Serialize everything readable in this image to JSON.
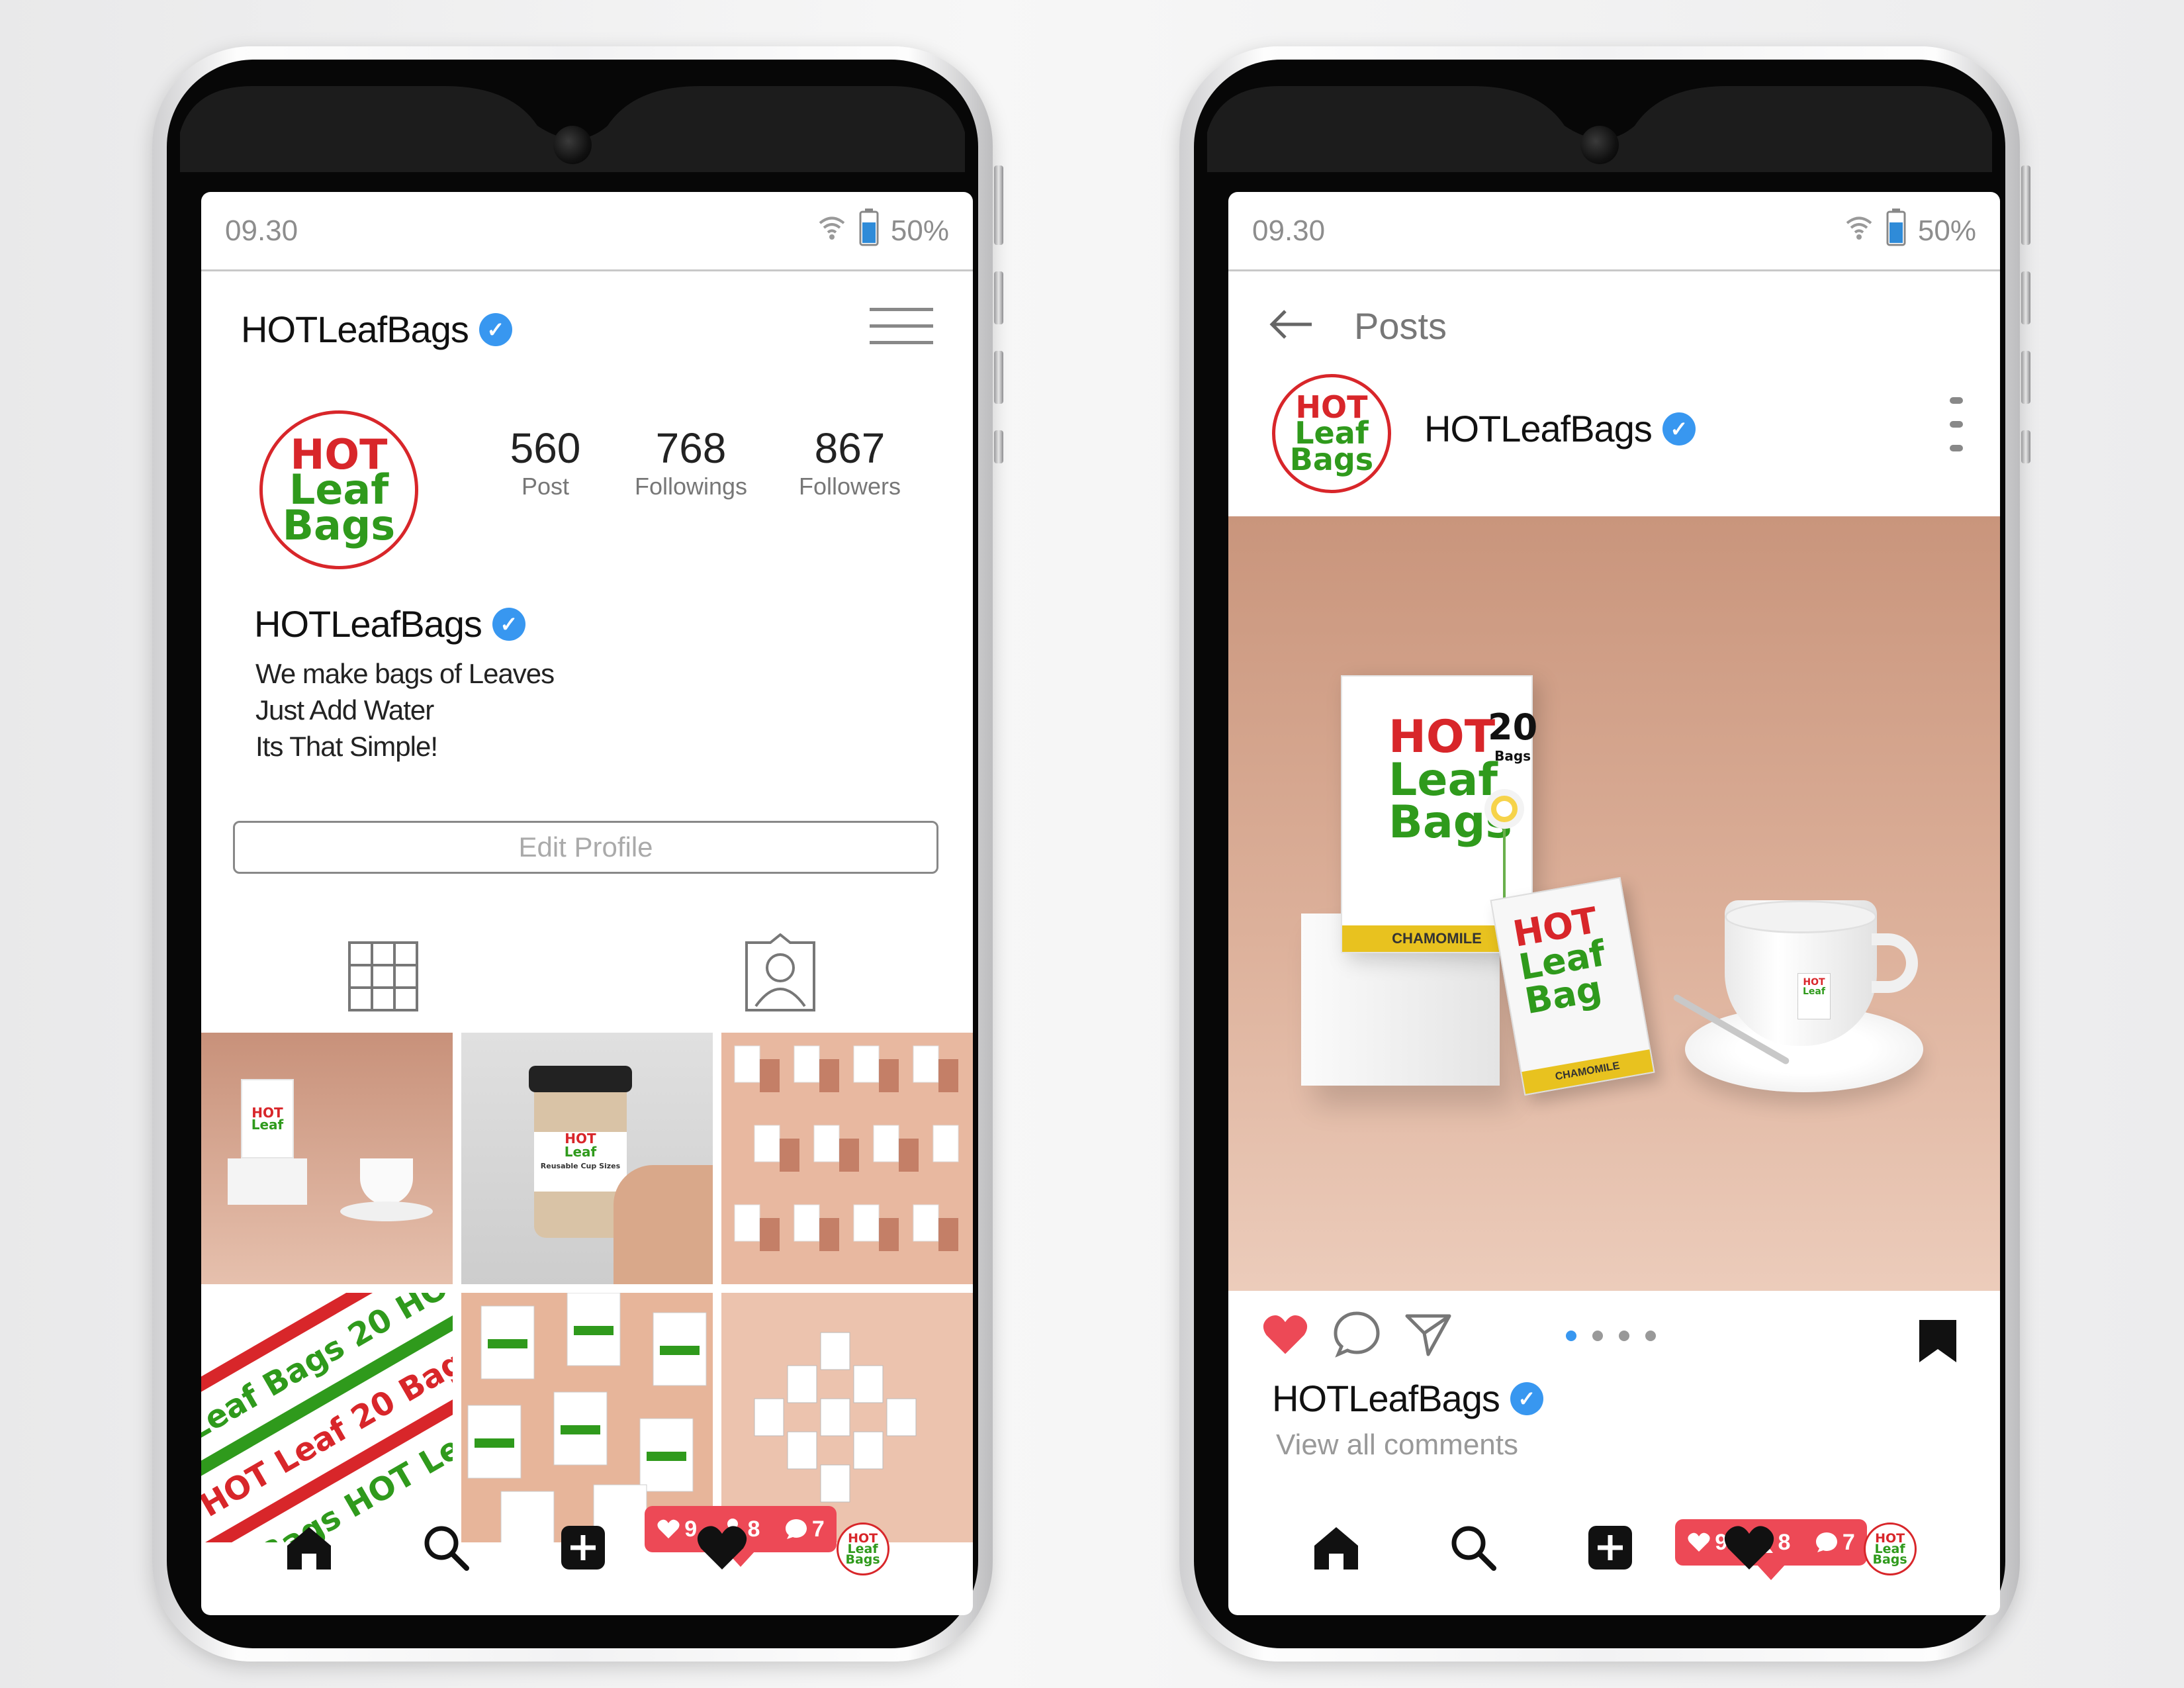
{
  "status_bar": {
    "time": "09.30",
    "battery": "50%"
  },
  "profile": {
    "username": "HOTLeafBags",
    "stats": [
      {
        "value": "560",
        "label": "Post"
      },
      {
        "value": "768",
        "label": "Followings"
      },
      {
        "value": "867",
        "label": "Followers"
      }
    ],
    "display_name": "HOTLeafBags",
    "bio": [
      "We make bags of Leaves",
      "Just Add Water",
      "Its That Simple!"
    ],
    "edit_button": "Edit Profile"
  },
  "logo_text": {
    "line1": "HOT",
    "line2": "Leaf",
    "line3": "Bags"
  },
  "post": {
    "header_title": "Posts",
    "username": "HOTLeafBags",
    "caption_user": "HOTLeafBags",
    "view_comments": "View all comments",
    "carousel_count": 4,
    "carousel_active": 1
  },
  "product": {
    "box_count": "20",
    "box_count_unit": "Bags",
    "sachet_line1": "HOT",
    "sachet_line2": "Leaf",
    "sachet_line3": "Bag",
    "flavor": "CHAMOMILE",
    "cup_text": "Reusable Cup Sizes"
  },
  "notifications": {
    "likes": "9",
    "follows": "8",
    "comments": "7"
  },
  "colors": {
    "accent_red": "#ed4956",
    "verified_blue": "#3897f0",
    "brand_red": "#d8262a",
    "brand_green": "#2f9a1c",
    "post_bg": "#d6a48c"
  }
}
